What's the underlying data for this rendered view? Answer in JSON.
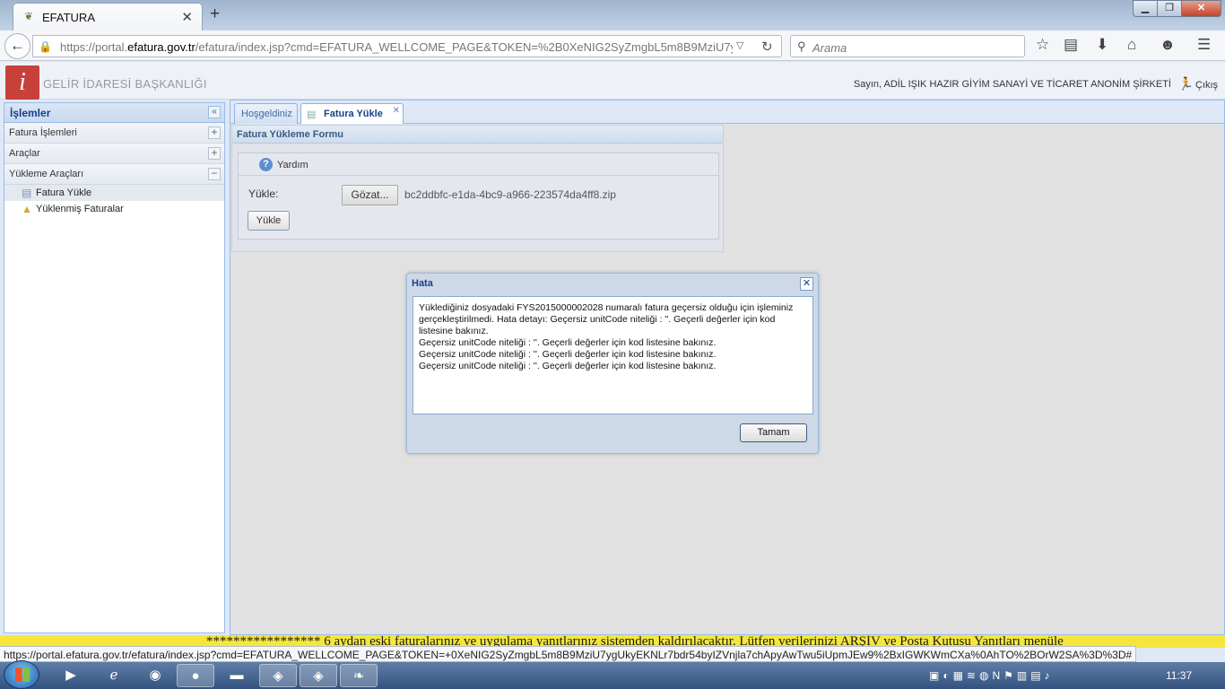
{
  "browser": {
    "tab_title": "EFATURA",
    "url_prefix": "https://portal.",
    "url_host": "efatura.gov.tr",
    "url_rest": "/efatura/index.jsp?cmd=EFATURA_WELLCOME_PAGE&TOKEN=%2B0XeNIG2SyZmgbL5m8B9MziU7ygUkyEKNLr7b",
    "search_placeholder": "Arama"
  },
  "header": {
    "brand": "GELİR İDARESİ BAŞKANLIĞI",
    "user_greeting": "Sayın, ADİL IŞIK HAZIR GİYİM SANAYİ VE TİCARET ANONİM ŞİRKETİ",
    "exit_label": "Çıkış"
  },
  "sidebar": {
    "title": "İşlemler",
    "sections": [
      {
        "label": "Fatura İşlemleri"
      },
      {
        "label": "Araçlar"
      },
      {
        "label": "Yükleme Araçları"
      }
    ],
    "items": [
      {
        "label": "Fatura Yükle"
      },
      {
        "label": "Yüklenmiş Faturalar"
      }
    ]
  },
  "tabs": [
    {
      "label": "Hoşgeldiniz"
    },
    {
      "label": "Fatura Yükle"
    }
  ],
  "form": {
    "title": "Fatura Yükleme Formu",
    "help_label": "Yardım",
    "field_label": "Yükle:",
    "browse_label": "Gözat...",
    "file_name": "bc2ddbfc-e1da-4bc9-a966-223574da4ff8.zip",
    "upload_label": "Yükle"
  },
  "dialog": {
    "title": "Hata",
    "lines": [
      "Yüklediğiniz dosyadaki FYS2015000002028 numaralı fatura geçersiz olduğu için işleminiz gerçekleştirilmedi. Hata detayı: Geçersiz unitCode niteliği : ''. Geçerli değerler için kod listesine bakınız.",
      "Geçersiz unitCode niteliği : ''. Geçerli değerler için kod listesine bakınız.",
      "Geçersiz unitCode niteliği : ''. Geçerli değerler için kod listesine bakınız.",
      "Geçersiz unitCode niteliği : ''. Geçerli değerler için kod listesine bakınız."
    ],
    "ok_label": "Tamam"
  },
  "marquee": "***************** 6 aydan eski faturalarınız ve uygulama yanıtlarınız sistemden kaldırılacaktır. Lütfen verilerinizi ARŞİV ve Posta Kutusu Yanıtları menüle",
  "status_url": "https://portal.efatura.gov.tr/efatura/index.jsp?cmd=EFATURA_WELLCOME_PAGE&TOKEN=+0XeNIG2SyZmgbL5m8B9MziU7ygUkyEKNLr7bdr54byIZVnjla7chApyAwTwu5iUpmJEw9%2BxIGWKWmCXa%0AhTO%2BOrW2SA%3D%3D#",
  "taskbar": {
    "clock": "11:37"
  }
}
